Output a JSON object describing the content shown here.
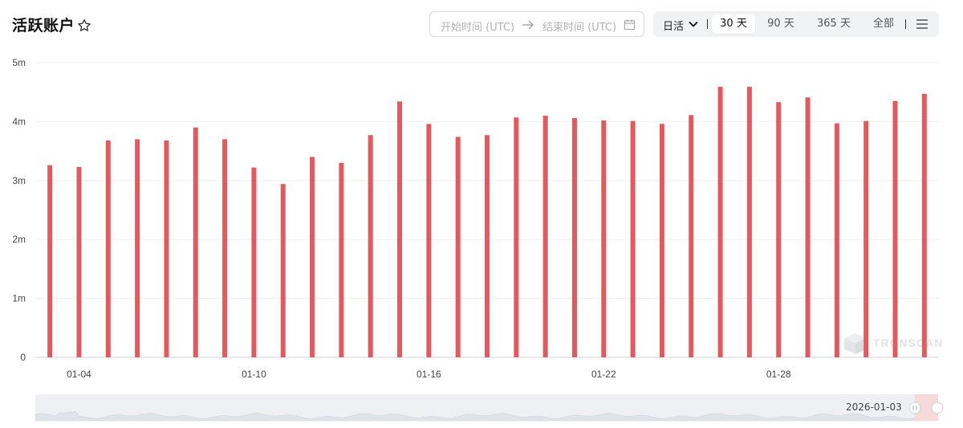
{
  "header": {
    "title": "活跃账户",
    "favorite_icon": "star-outline-icon"
  },
  "date_range": {
    "start_placeholder": "开始时间 (UTC)",
    "end_placeholder": "结束时间 (UTC)",
    "arrow_icon": "arrow-right-icon",
    "calendar_icon": "calendar-icon"
  },
  "filters": {
    "metric_select": "日活",
    "ranges": [
      "30 天",
      "90 天",
      "365 天",
      "全部"
    ],
    "active_range": "30 天",
    "menu_icon": "menu-icon"
  },
  "chart_data": {
    "type": "bar",
    "title": "",
    "xlabel": "",
    "ylabel": "",
    "ylim": [
      0,
      5000000
    ],
    "y_ticks": [
      "0",
      "1m",
      "2m",
      "3m",
      "4m",
      "5m"
    ],
    "x_tick_labels": [
      "01-04",
      "01-10",
      "01-16",
      "01-22",
      "01-28"
    ],
    "categories": [
      "01-03",
      "01-04",
      "01-05",
      "01-06",
      "01-07",
      "01-08",
      "01-09",
      "01-10",
      "01-11",
      "01-12",
      "01-13",
      "01-14",
      "01-15",
      "01-16",
      "01-17",
      "01-18",
      "01-19",
      "01-20",
      "01-21",
      "01-22",
      "01-23",
      "01-24",
      "01-25",
      "01-26",
      "01-27",
      "01-28",
      "01-29",
      "01-30",
      "01-31",
      "02-01",
      "02-02"
    ],
    "values": [
      3260000,
      3230000,
      3680000,
      3700000,
      3680000,
      3900000,
      3700000,
      3220000,
      2940000,
      3400000,
      3300000,
      3770000,
      4340000,
      3960000,
      3740000,
      3770000,
      4070000,
      4100000,
      4060000,
      4020000,
      4010000,
      3960000,
      4110000,
      4590000,
      4590000,
      4330000,
      4410000,
      3970000,
      4010000,
      4350000,
      4470000
    ],
    "bar_color": "#e05a5f",
    "grid": true,
    "watermark": "TRONSCAN"
  },
  "zoom_slider": {
    "start_label": "2026-01-03",
    "handle_icon": "pause-handle-icon"
  }
}
